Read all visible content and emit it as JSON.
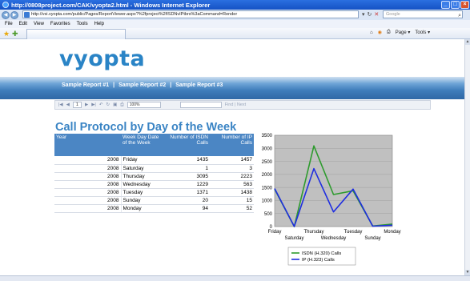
{
  "window": {
    "title": "http://0808project.com/CAK/vyopta2.html - Windows Internet Explorer"
  },
  "address": {
    "url": "http://vsi.vyopta.com/public/Pages/ReportViewer.aspx?%2fproject%2fISDNvIPtbrs%3aCommand=Render",
    "search_placeholder": "Google"
  },
  "menu": {
    "items": [
      "File",
      "Edit",
      "View",
      "Favorites",
      "Tools",
      "Help"
    ]
  },
  "commandbar": {
    "page_label": "Page",
    "tools_label": "Tools"
  },
  "site": {
    "logo": "vyopta",
    "reports": [
      "Sample Report #1",
      "Sample Report #2",
      "Sample Report #3"
    ],
    "separator": "|"
  },
  "viewer": {
    "page": "1",
    "zoom": "100%",
    "find_label": "Find | Next"
  },
  "report": {
    "title": "Call Protocol by Day of the Week",
    "columns": [
      "Year",
      "Week Day Date of the Week",
      "Number of ISDN Calls",
      "Number of IP Calls"
    ],
    "rows": [
      {
        "year": "2008",
        "day": "Friday",
        "isdn": "1435",
        "ip": "1457"
      },
      {
        "year": "2008",
        "day": "Saturday",
        "isdn": "1",
        "ip": "3"
      },
      {
        "year": "2008",
        "day": "Thursday",
        "isdn": "3095",
        "ip": "2223"
      },
      {
        "year": "2008",
        "day": "Wednesday",
        "isdn": "1229",
        "ip": "563"
      },
      {
        "year": "2008",
        "day": "Tuesday",
        "isdn": "1371",
        "ip": "1438"
      },
      {
        "year": "2008",
        "day": "Sunday",
        "isdn": "20",
        "ip": "15"
      },
      {
        "year": "2008",
        "day": "Monday",
        "isdn": "94",
        "ip": "52"
      }
    ]
  },
  "chart_data": {
    "type": "line",
    "categories": [
      "Friday",
      "Saturday",
      "Thursday",
      "Wednesday",
      "Tuesday",
      "Sunday",
      "Monday"
    ],
    "series": [
      {
        "name": "ISDN (H.320) Calls",
        "values": [
          1435,
          1,
          3095,
          1229,
          1371,
          20,
          94
        ],
        "color": "#2e9b2e"
      },
      {
        "name": "IP (H.323) Calls",
        "values": [
          1457,
          3,
          2223,
          563,
          1438,
          15,
          52
        ],
        "color": "#1f2ee0"
      }
    ],
    "ylim": [
      0,
      3500
    ],
    "yticks": [
      0,
      500,
      1000,
      1500,
      2000,
      2500,
      3000,
      3500
    ],
    "grid": true,
    "legend": "bottom",
    "plot_background": "#c0c0c0"
  }
}
